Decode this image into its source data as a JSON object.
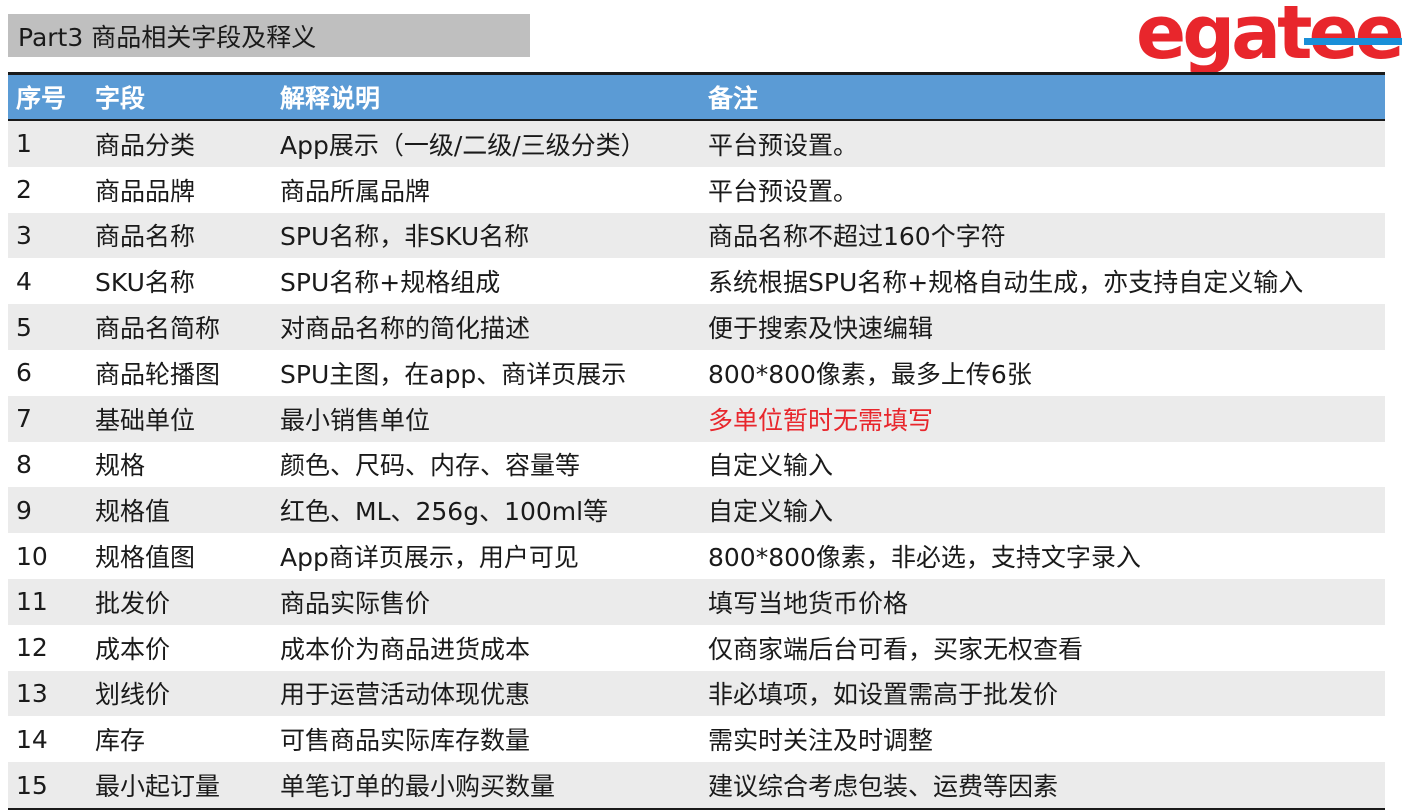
{
  "title": "Part3 商品相关字段及释义",
  "logo": {
    "text": "egatee",
    "colors": {
      "primary": "#e8262c",
      "accent": "#1a8fd8"
    }
  },
  "table": {
    "headers": [
      "序号",
      "字段",
      "解释说明",
      "备注"
    ],
    "rows": [
      [
        "1",
        "商品分类",
        "App展示（一级/二级/三级分类）",
        "平台预设置。"
      ],
      [
        "2",
        "商品品牌",
        "商品所属品牌",
        "平台预设置。"
      ],
      [
        "3",
        "商品名称",
        "SPU名称，非SKU名称",
        "商品名称不超过160个字符"
      ],
      [
        "4",
        "SKU名称",
        "SPU名称+规格组成",
        "系统根据SPU名称+规格自动生成，亦支持自定义输入"
      ],
      [
        "5",
        "商品名简称",
        "对商品名称的简化描述",
        "便于搜索及快速编辑"
      ],
      [
        "6",
        "商品轮播图",
        "SPU主图，在app、商详页展示",
        "800*800像素，最多上传6张"
      ],
      [
        "7",
        "基础单位",
        "最小销售单位",
        "多单位暂时无需填写"
      ],
      [
        "8",
        "规格",
        "颜色、尺码、内存、容量等",
        "自定义输入"
      ],
      [
        "9",
        "规格值",
        "红色、ML、256g、100ml等",
        "自定义输入"
      ],
      [
        "10",
        "规格值图",
        "App商详页展示，用户可见",
        "800*800像素，非必选，支持文字录入"
      ],
      [
        "11",
        "批发价",
        "商品实际售价",
        "填写当地货币价格"
      ],
      [
        "12",
        "成本价",
        "成本价为商品进货成本",
        "仅商家端后台可看，买家无权查看"
      ],
      [
        "13",
        "划线价",
        "用于运营活动体现优惠",
        "非必填项，如设置需高于批发价"
      ],
      [
        "14",
        "库存",
        "可售商品实际库存数量",
        "需实时关注及时调整"
      ],
      [
        "15",
        "最小起订量",
        "单笔订单的最小购买数量",
        "建议综合考虑包装、运费等因素"
      ]
    ],
    "highlight_color": "#e8262c",
    "header_color": "#5b9bd5"
  }
}
